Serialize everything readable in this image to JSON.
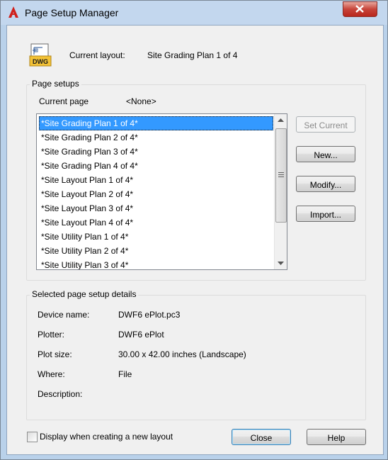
{
  "window": {
    "title": "Page Setup Manager",
    "app_icon": "autocad-a-icon",
    "close_icon": "close-x-icon"
  },
  "current_layout": {
    "icon": "dwg-file-icon",
    "label": "Current layout:",
    "value": "Site Grading Plan 1 of 4"
  },
  "page_setups": {
    "group_title": "Page setups",
    "current_page_label": "Current page",
    "current_page_value": "<None>",
    "items": [
      "*Site Grading Plan 1 of 4*",
      "*Site Grading Plan 2 of 4*",
      "*Site Grading Plan 3 of 4*",
      "*Site Grading Plan 4 of 4*",
      "*Site Layout Plan 1 of 4*",
      "*Site Layout Plan 2 of 4*",
      "*Site Layout Plan 3 of 4*",
      "*Site Layout Plan 4 of 4*",
      "*Site Utility Plan 1 of 4*",
      "*Site Utility Plan 2 of 4*",
      "*Site Utility Plan 3 of 4*"
    ],
    "selected_index": 0,
    "buttons": {
      "set_current": "Set Current",
      "new": "New...",
      "modify": "Modify...",
      "import": "Import..."
    }
  },
  "details": {
    "group_title": "Selected page setup details",
    "rows": [
      {
        "label": "Device name:",
        "value": "DWF6 ePlot.pc3"
      },
      {
        "label": "Plotter:",
        "value": "DWF6 ePlot"
      },
      {
        "label": "Plot size:",
        "value": "30.00 x 42.00 inches (Landscape)"
      },
      {
        "label": "Where:",
        "value": "File"
      },
      {
        "label": "Description:",
        "value": ""
      }
    ]
  },
  "footer": {
    "checkbox_label": "Display when creating a new layout",
    "checkbox_checked": false,
    "close": "Close",
    "help": "Help"
  },
  "colors": {
    "selection": "#3399ff",
    "close_button": "#c7443a",
    "frame": "#b9d1ea"
  }
}
